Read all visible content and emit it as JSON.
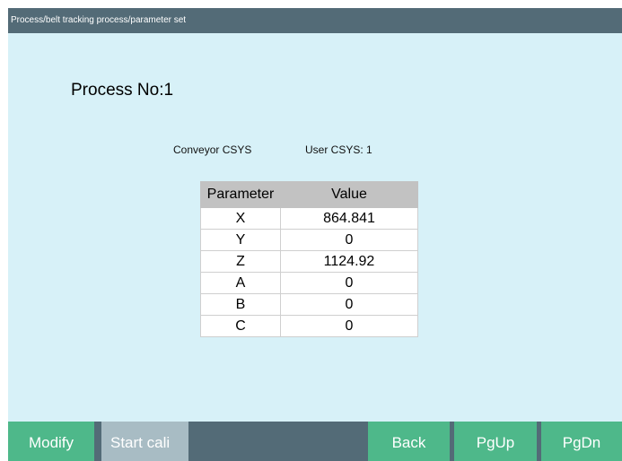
{
  "header": {
    "title": "Process/belt tracking process/parameter set"
  },
  "process": {
    "label": "Process No:1"
  },
  "csys": {
    "conveyor": "Conveyor CSYS",
    "user": "User CSYS: 1"
  },
  "table": {
    "headers": [
      "Parameter",
      "Value"
    ],
    "rows": [
      [
        "X",
        "864.841"
      ],
      [
        "Y",
        "0"
      ],
      [
        "Z",
        "1124.92"
      ],
      [
        "A",
        "0"
      ],
      [
        "B",
        "0"
      ],
      [
        "C",
        "0"
      ]
    ]
  },
  "buttons": {
    "modify": "Modify",
    "start_cali": "Start cali",
    "back": "Back",
    "pgup": "PgUp",
    "pgdn": "PgDn"
  },
  "colors": {
    "title_bar": "#536b77",
    "content_bg": "#d7f1f8",
    "button_green": "#4eb88a",
    "button_gray": "#a8bcc4",
    "table_header": "#c2c2c2"
  }
}
